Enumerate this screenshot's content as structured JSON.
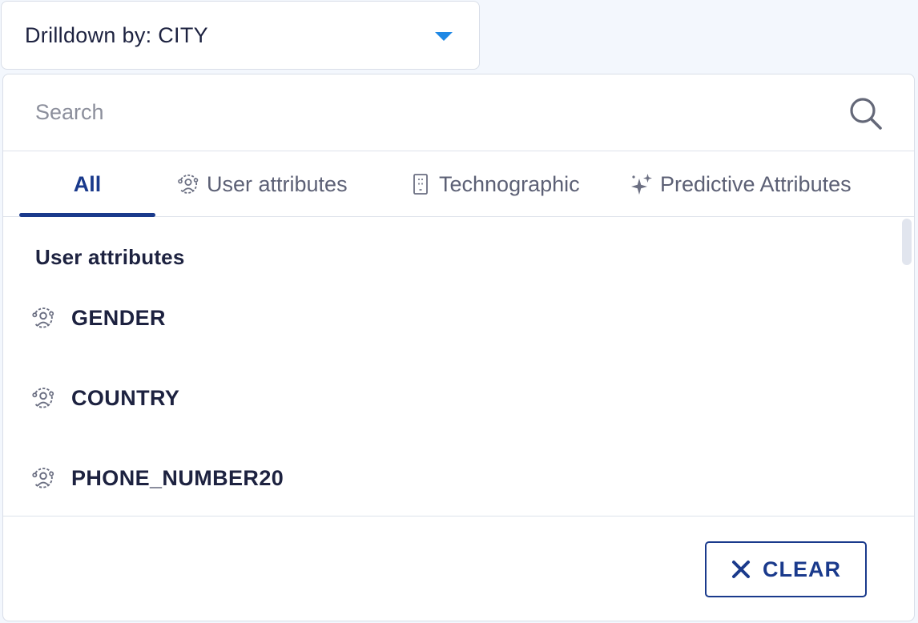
{
  "drilldown": {
    "label": "Drilldown by: CITY",
    "caret_icon": "caret-down-icon",
    "accent_color": "#1e88e5"
  },
  "search": {
    "placeholder": "Search",
    "value": "",
    "icon": "search-icon"
  },
  "tabs": [
    {
      "label": "All",
      "icon": "",
      "active": true
    },
    {
      "label": "User attributes",
      "icon": "user-attribute-icon",
      "active": false
    },
    {
      "label": "Technographic",
      "icon": "device-icon",
      "active": false
    },
    {
      "label": "Predictive Attributes",
      "icon": "sparkle-icon",
      "active": false
    }
  ],
  "sections": [
    {
      "heading": "User attributes",
      "items": [
        {
          "label": "GENDER",
          "icon": "user-attribute-icon"
        },
        {
          "label": "COUNTRY",
          "icon": "user-attribute-icon"
        },
        {
          "label": "PHONE_NUMBER20",
          "icon": "user-attribute-icon"
        }
      ]
    }
  ],
  "footer": {
    "clear_label": "CLEAR",
    "clear_icon": "close-icon"
  },
  "colors": {
    "primary": "#1a3a8c",
    "text": "#1d2240",
    "muted": "#5c6075",
    "border": "#d9dee8",
    "background": "#f3f7fd"
  }
}
